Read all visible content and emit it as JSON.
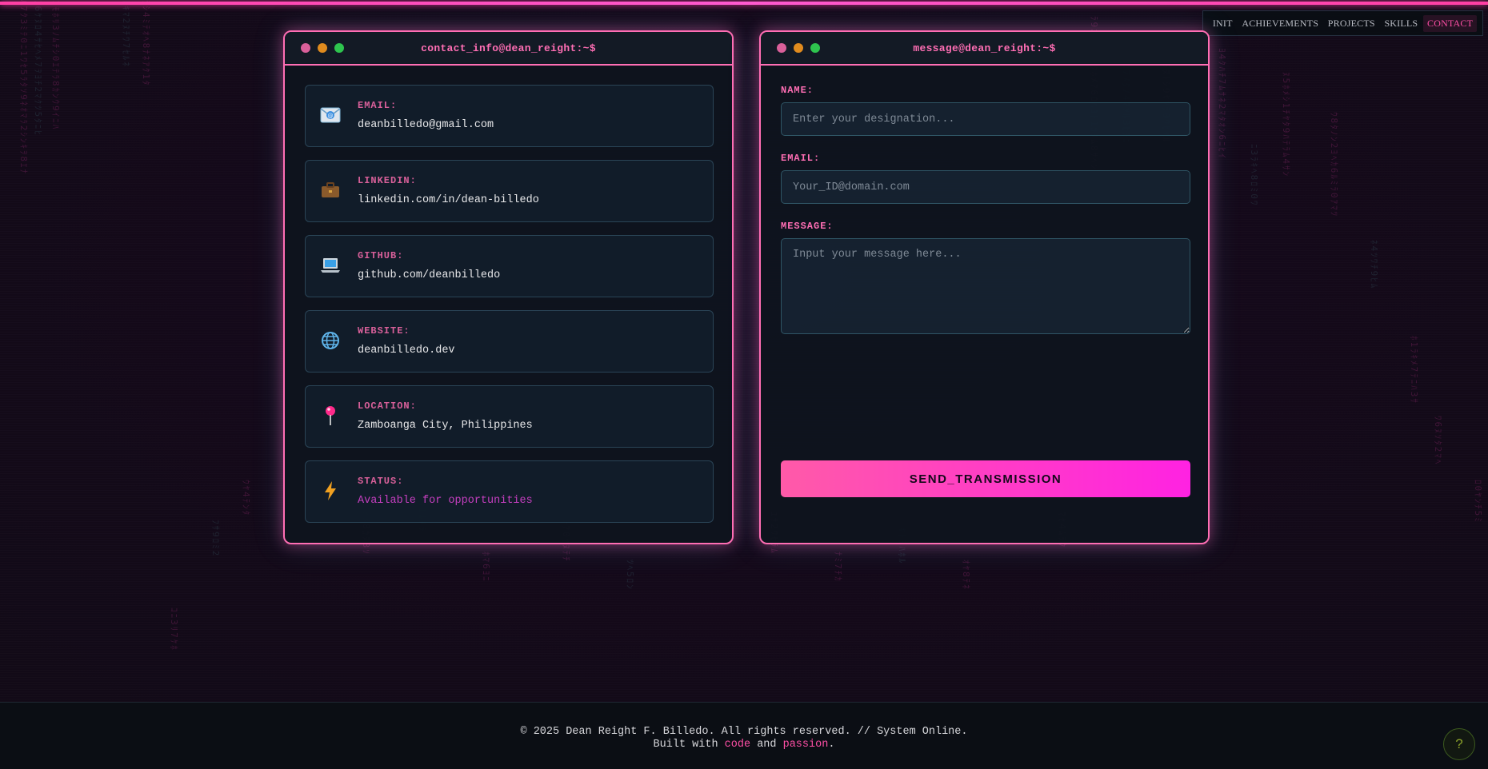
{
  "nav": {
    "items": [
      {
        "label": "INIT",
        "active": false
      },
      {
        "label": "ACHIEVEMENTS",
        "active": false
      },
      {
        "label": "PROJECTS",
        "active": false
      },
      {
        "label": "SKILLS",
        "active": false
      },
      {
        "label": "CONTACT",
        "active": true
      }
    ]
  },
  "contact_panel": {
    "title": "contact_info@dean_reight:~$",
    "cards": [
      {
        "icon": "email-icon",
        "label": "EMAIL:",
        "value": "deanbilledo@gmail.com"
      },
      {
        "icon": "briefcase-icon",
        "label": "LINKEDIN:",
        "value": "linkedin.com/in/dean-billedo"
      },
      {
        "icon": "laptop-icon",
        "label": "GITHUB:",
        "value": "github.com/deanbilledo"
      },
      {
        "icon": "globe-icon",
        "label": "WEBSITE:",
        "value": "deanbilledo.dev"
      },
      {
        "icon": "pin-icon",
        "label": "LOCATION:",
        "value": "Zamboanga City, Philippines"
      },
      {
        "icon": "lightning-icon",
        "label": "STATUS:",
        "value": "Available for opportunities"
      }
    ]
  },
  "message_panel": {
    "title": "message@dean_reight:~$",
    "name_label": "NAME:",
    "name_placeholder": "Enter your designation...",
    "email_label": "EMAIL:",
    "email_placeholder": "Your_ID@domain.com",
    "message_label": "MESSAGE:",
    "message_placeholder": "Input your message here...",
    "send_label": "SEND_TRANSMISSION"
  },
  "footer": {
    "line1": "© 2025 Dean Reight F. Billedo. All rights reserved. // System Online.",
    "built_with": "Built with",
    "code": "code",
    "and": "and",
    "passion": "passion",
    "period": "."
  },
  "help": {
    "label": "?"
  },
  "colors": {
    "accent_pink": "#ff6eb4",
    "accent_magenta": "#ff22e2",
    "status_purple": "#c63fc0"
  }
}
